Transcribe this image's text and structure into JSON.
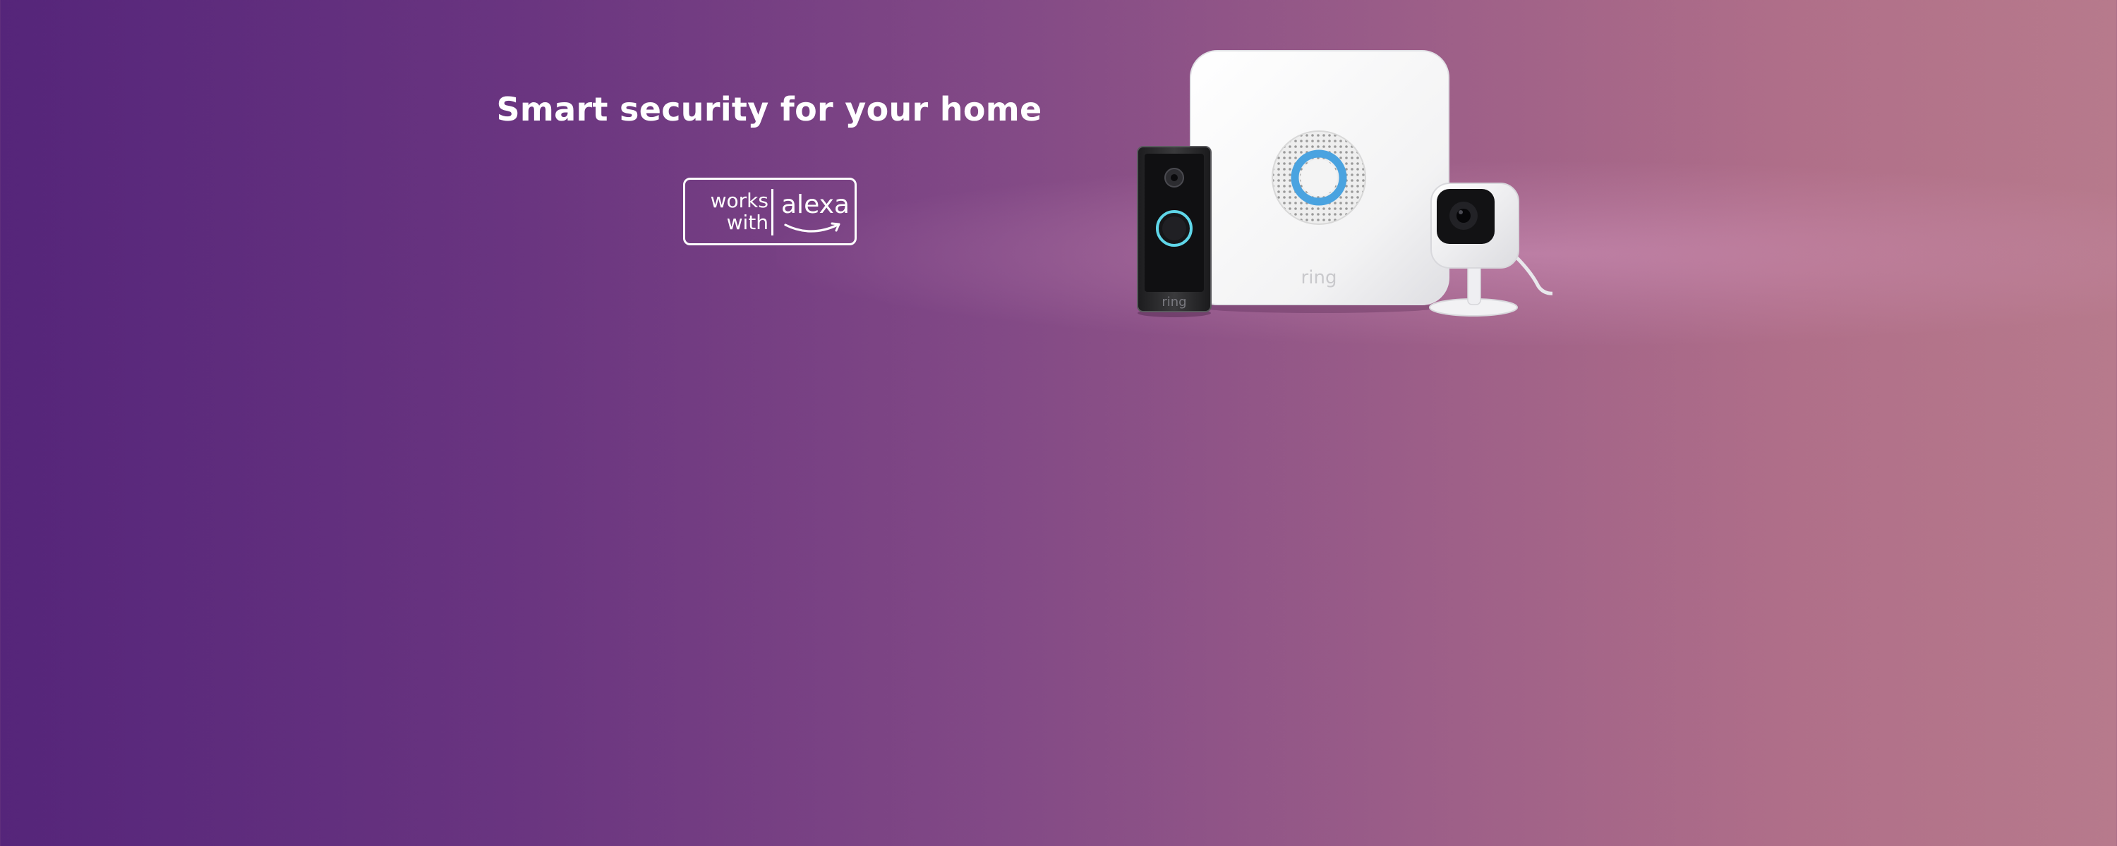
{
  "banner": {
    "headline": "Smart security for your home",
    "badge": {
      "line1": "works",
      "line2": "with",
      "brand": "alexa"
    },
    "products": [
      {
        "name": "video-doorbell",
        "logo": "ring"
      },
      {
        "name": "alarm-base-station",
        "logo": "ring"
      },
      {
        "name": "indoor-camera",
        "logo": ""
      }
    ]
  },
  "colors": {
    "background_left": "#55257a",
    "background_right": "#b77a8c",
    "text": "#ffffff",
    "ring_blue": "#4aa3e0"
  }
}
